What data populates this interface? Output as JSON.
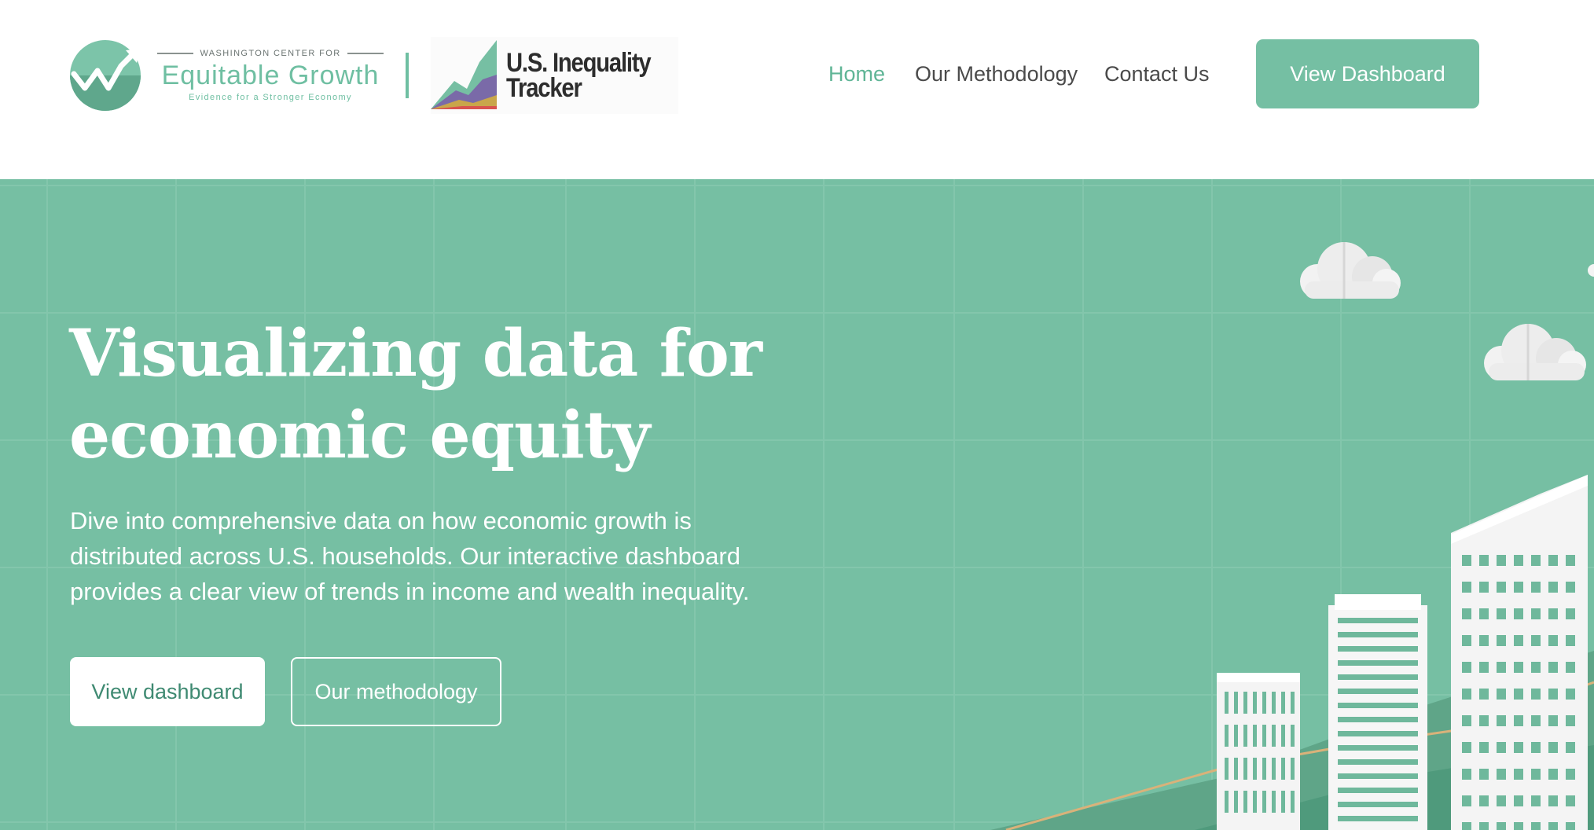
{
  "header": {
    "org_logo": {
      "top_line": "WASHINGTON CENTER FOR",
      "name": "Equitable Growth",
      "tagline": "Evidence for a Stronger Economy"
    },
    "product_logo": {
      "line1": "U.S. Inequality",
      "line2": "Tracker"
    },
    "nav": [
      {
        "label": "Home",
        "active": true
      },
      {
        "label": "Our Methodology",
        "active": false
      },
      {
        "label": "Contact Us",
        "active": false
      }
    ],
    "cta_label": "View Dashboard"
  },
  "hero": {
    "title_line1": "Visualizing data for",
    "title_line2": "economic equity",
    "description": "Dive into comprehensive data on how economic growth is distributed across U.S. households. Our interactive dashboard provides a clear view of trends in income and wealth inequality.",
    "primary_button": "View dashboard",
    "secondary_button": "Our methodology"
  },
  "colors": {
    "brand_green": "#75bfa3",
    "nav_active": "#5fb596",
    "nav_text": "#4a4a4a",
    "hero_bg": "#76bfa3",
    "white": "#ffffff"
  }
}
